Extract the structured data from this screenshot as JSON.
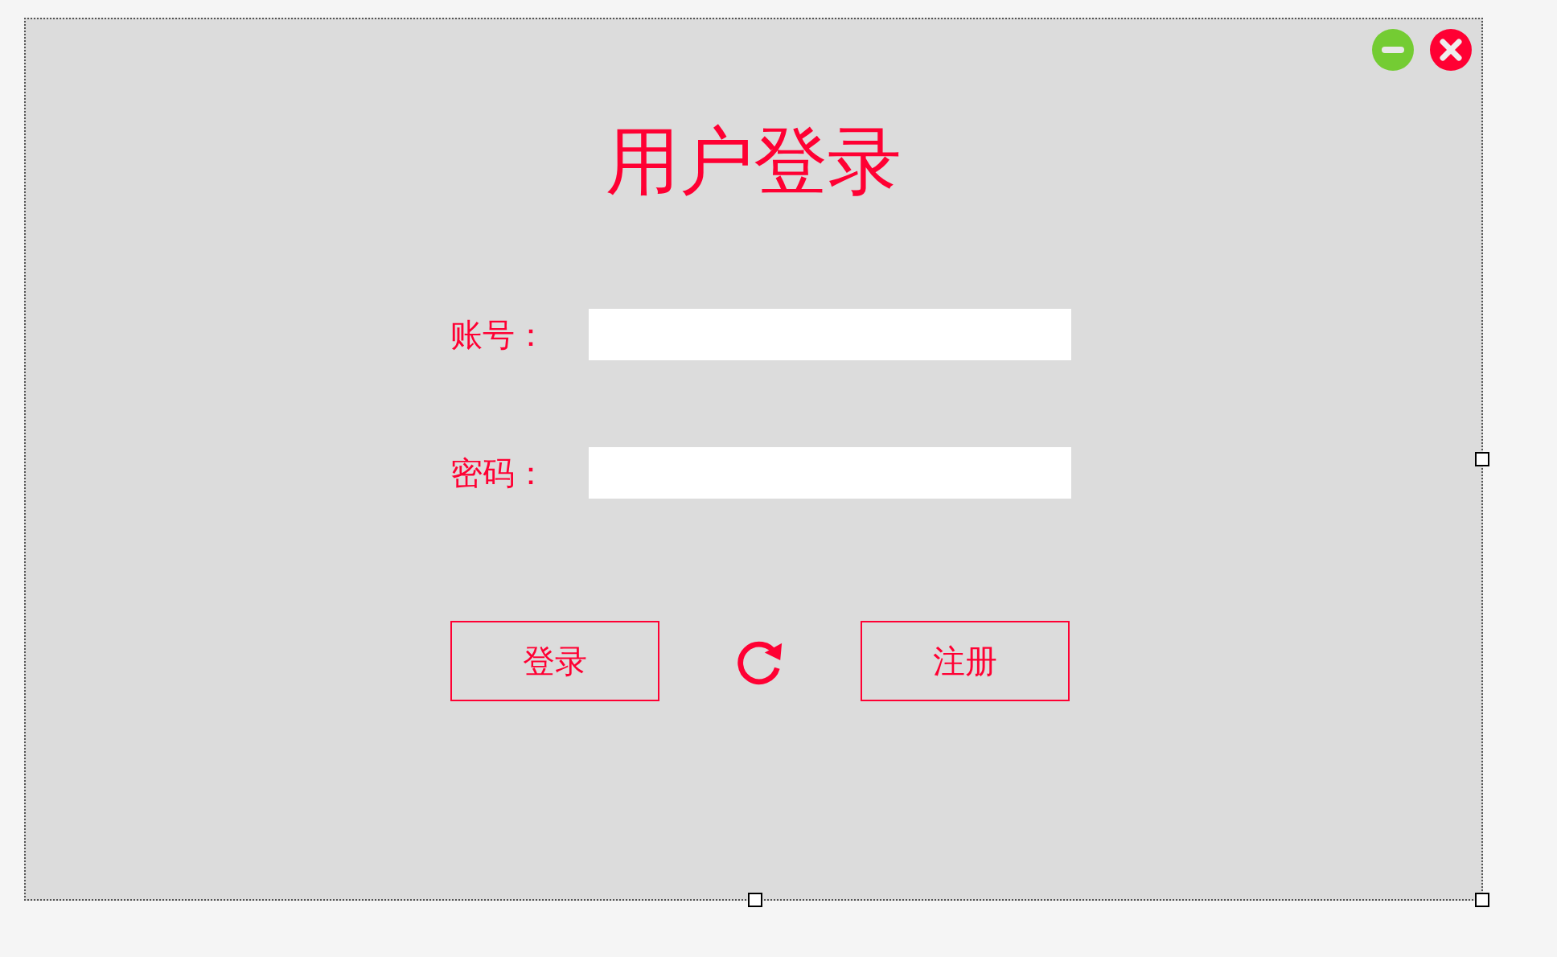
{
  "title": "用户登录",
  "fields": [
    {
      "label": "账号："
    },
    {
      "label": "密码："
    }
  ],
  "buttons": [
    {
      "label": "登录"
    },
    {
      "label": "注册"
    }
  ]
}
